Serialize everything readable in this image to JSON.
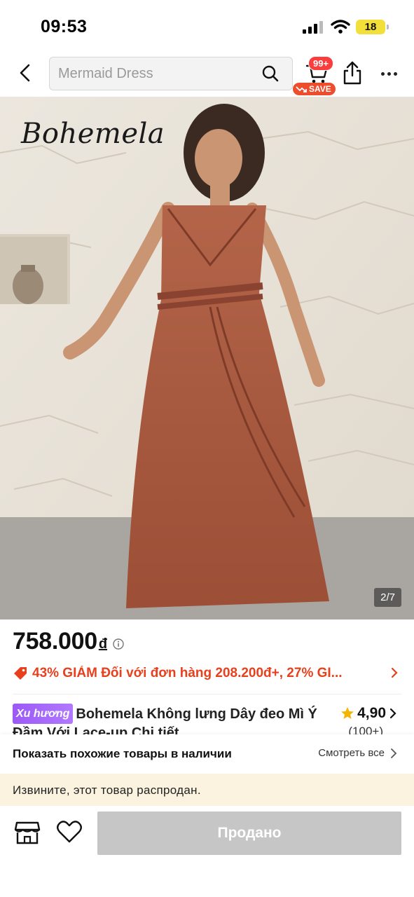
{
  "status_bar": {
    "time": "09:53",
    "battery": "18",
    "battery_color": "#f3df3a"
  },
  "header": {
    "search_placeholder": "Mermaid Dress",
    "cart_count": "99+",
    "save_label": "SAVE",
    "icons": [
      "back-chevron-icon",
      "search-icon",
      "cart-icon",
      "share-icon",
      "more-icon"
    ]
  },
  "image": {
    "brand_logo": "Bohemela",
    "counter": "2/7"
  },
  "price": {
    "amount": "758.000",
    "currency": "đ"
  },
  "promo": {
    "text": "43% GIẢM Đối với đơn hàng 208.200đ+,  27% GI..."
  },
  "product": {
    "badge": "Xu hương",
    "title": "Bohemela Không lưng Dây đeo Mì Ý  Đầm Với Lace-up Chi tiết",
    "rating": "4,90",
    "rating_count": "(100+)"
  },
  "similar": {
    "title": "Показать похожие товары в наличии",
    "link": "Смотреть все"
  },
  "notice": {
    "text": "Извините, этот товар распродан."
  },
  "bottom": {
    "button_label": "Продано"
  },
  "colors": {
    "accent": "#ee4d2d",
    "promo": "#e8401c",
    "trend_badge": "#9b59f6",
    "sold_out_button": "#c6c6c6",
    "notice_bg": "#fbf3df",
    "star": "#f5b400"
  }
}
